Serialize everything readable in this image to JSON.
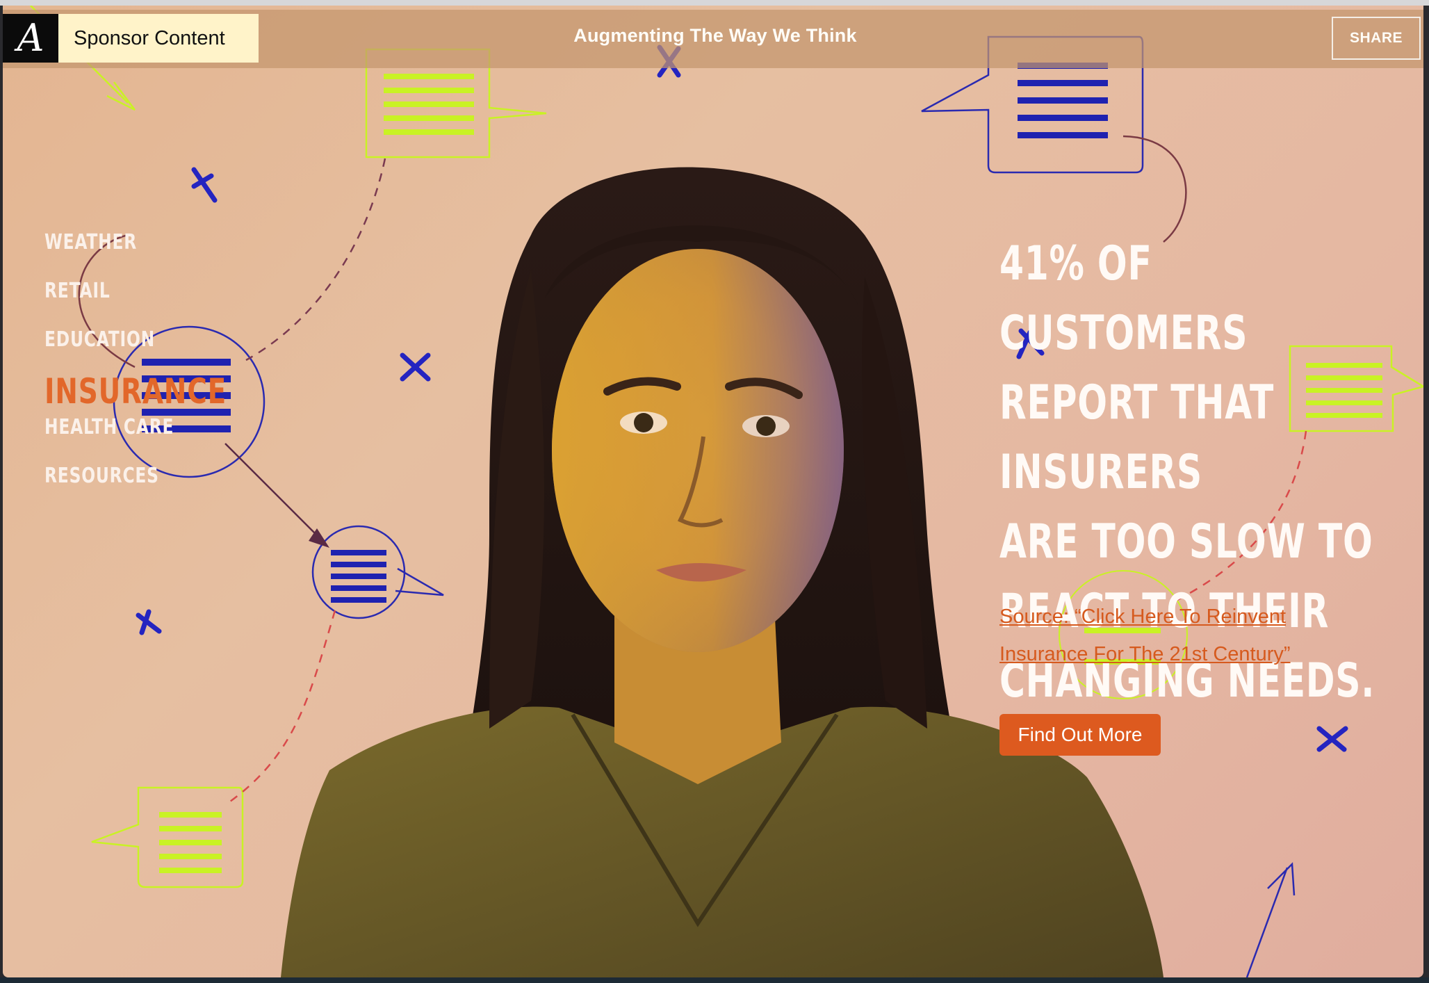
{
  "header": {
    "logo_letter": "A",
    "sponsor_label": "Sponsor Content",
    "title": "Augmenting The Way We Think",
    "share_label": "SHARE"
  },
  "nav": {
    "items": [
      {
        "label": "WEATHER",
        "active": false
      },
      {
        "label": "RETAIL",
        "active": false
      },
      {
        "label": "EDUCATION",
        "active": false
      },
      {
        "label": "INSURANCE",
        "active": true
      },
      {
        "label": "HEALTH CARE",
        "active": false
      },
      {
        "label": "RESOURCES",
        "active": false
      }
    ]
  },
  "main": {
    "headline_lines": [
      "41% OF CUSTOMERS",
      "REPORT THAT INSURERS",
      "ARE TOO SLOW TO",
      "REACT TO THEIR",
      "CHANGING NEEDS."
    ],
    "source_line1": "Source: “Click Here To Reinvent",
    "source_line2": "Insurance For The 21st Century”",
    "cta_label": "Find Out More"
  },
  "colors": {
    "accent_orange": "#dd5a1f",
    "nav_active": "#e2672a",
    "doodle_blue": "#1f22b0",
    "doodle_lime": "#c9f224",
    "sponsor_tab_bg": "#fff3c9"
  }
}
